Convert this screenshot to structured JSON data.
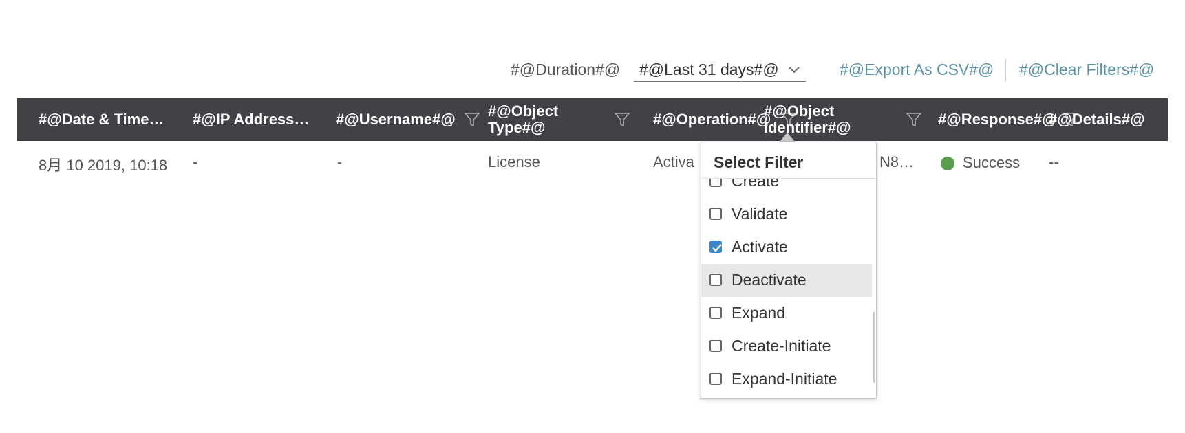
{
  "toolbar": {
    "duration_label": "#@Duration#@",
    "duration_value": "#@Last 31 days#@",
    "export_label": "#@Export As CSV#@",
    "clear_label": "#@Clear Filters#@"
  },
  "table": {
    "headers": [
      {
        "label": "#@Date & Time…",
        "filter": false
      },
      {
        "label": "#@IP Address…",
        "filter": false
      },
      {
        "label": "#@Username#@",
        "filter": true
      },
      {
        "label": "#@Object\nType#@",
        "filter": true
      },
      {
        "label": "#@Operation#@",
        "filter": true
      },
      {
        "label": "#@Object\nIdentifier#@",
        "filter": true
      },
      {
        "label": "#@Response#@",
        "filter": true
      },
      {
        "label": "#@Details#@",
        "filter": false
      }
    ],
    "rows": [
      {
        "date_time": "8月 10 2019, 10:18",
        "ip": "-",
        "username": "-",
        "object_type": "License",
        "operation": "Activa",
        "object_identifier": "N8…",
        "response": "Success",
        "details": "--"
      }
    ]
  },
  "filter_popup": {
    "title": "Select Filter",
    "options": [
      {
        "label": "Create",
        "checked": false
      },
      {
        "label": "Validate",
        "checked": false
      },
      {
        "label": "Activate",
        "checked": true
      },
      {
        "label": "Deactivate",
        "checked": false
      },
      {
        "label": "Expand",
        "checked": false
      },
      {
        "label": "Create-Initiate",
        "checked": false
      },
      {
        "label": "Expand-Initiate",
        "checked": false
      }
    ]
  },
  "colors": {
    "header_bg": "#404245",
    "link": "#5a93a6",
    "success": "#5a9e4b",
    "checkbox_on": "#3a86c8"
  }
}
